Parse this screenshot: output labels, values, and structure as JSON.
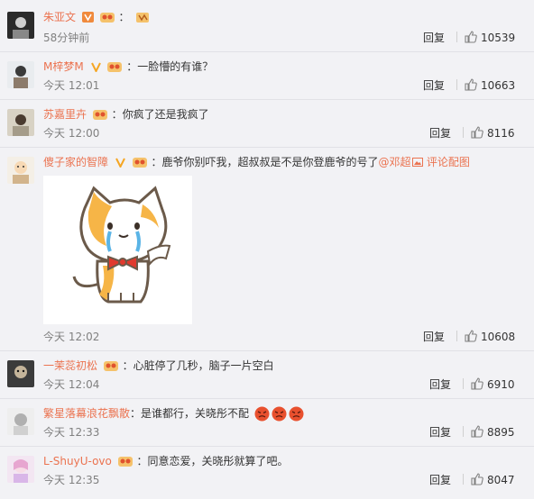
{
  "colors": {
    "username": "#eb7350",
    "mention": "#eb7350",
    "time": "#808080",
    "background": "#f2f2f5"
  },
  "actions": {
    "reply_label": "回复",
    "like_icon": "thumbs-up-icon"
  },
  "comments": [
    {
      "username": "朱亚文",
      "text": "",
      "time": "58分钟前",
      "likes": "10539"
    },
    {
      "username": "M梓梦M",
      "text": "：一脸懵的有谁？",
      "time": "今天 12:01",
      "likes": "10663"
    },
    {
      "username": "苏嘉里卉",
      "text": "：你疯了还是我疯了",
      "time": "今天 12:00",
      "likes": "8116"
    },
    {
      "username": "傻子家的智障",
      "text": "：鹿爷你别吓我，超叔叔是不是你登鹿爷的号了",
      "mention": "@邓超",
      "view_pic": "评论配图",
      "time": "今天 12:02",
      "likes": "10608"
    },
    {
      "username": "一茉蕊初松",
      "text": "：心脏停了几秒，脑子一片空白",
      "time": "今天 12:04",
      "likes": "6910"
    },
    {
      "username": "繁星落幕浪花飘散",
      "text": "：是谁都行，关晓彤不配",
      "time": "今天 12:33",
      "likes": "8895"
    },
    {
      "username": "L-ShuyU-ovo",
      "text": "：同意恋爱，关晓彤就算了吧。",
      "time": "今天 12:35",
      "likes": "8047"
    }
  ]
}
